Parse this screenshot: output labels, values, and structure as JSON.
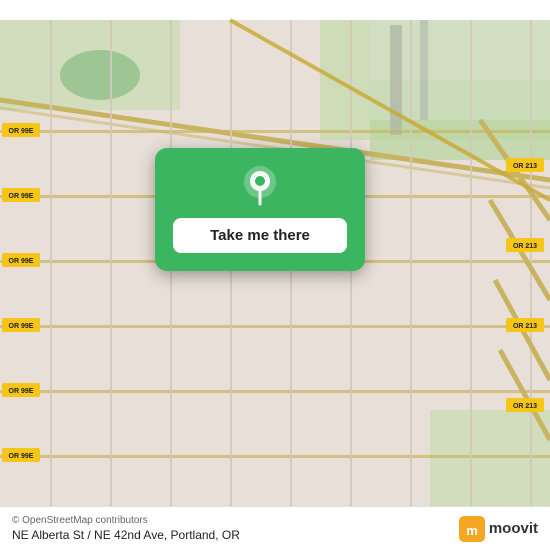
{
  "map": {
    "bg_color": "#e8e0d8",
    "center_lat": 45.558,
    "center_lng": -122.618
  },
  "popup": {
    "button_label": "Take me there",
    "bg_color": "#3cb561",
    "pin_color": "white"
  },
  "bottom_bar": {
    "location_text": "NE Alberta St / NE 42nd Ave, Portland, OR",
    "attribution": "© OpenStreetMap contributors",
    "logo_text": "moovit"
  },
  "road_labels": [
    "OR 99E",
    "OR 213"
  ]
}
